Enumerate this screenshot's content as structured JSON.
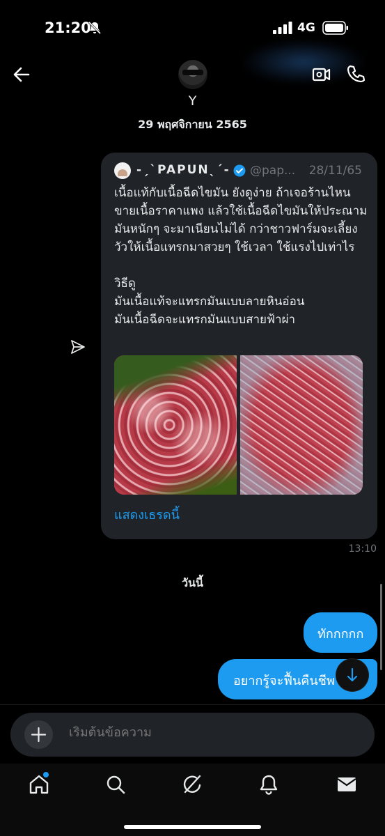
{
  "status_bar": {
    "time": "21:20",
    "network": "4G"
  },
  "header": {
    "contact_name": "Y"
  },
  "conversation": {
    "date_separator": "29 พฤศจิกายน 2565",
    "shared_tweet": {
      "author_name": "-ˏˋPAPUNˎˊ-",
      "handle": "@pap...",
      "date": "28/11/65",
      "text": "เนื้อแท้กับเนื้อฉีดไขมัน ยังดูง่าย ถ้าเจอร้านไหนขายเนื้อราคาแพง แล้วใช้เนื้อฉีดไขมันให้ประณามมันหนักๆ จะมาเนียนไม่ได้  กว่าชาวฟาร์มจะเลี้ยงวัวให้เนื้อแทรกมาสวยๆ ใช้เวลา ใช้แรงไปเท่าไร\n\nวิธีดู\nมันเนื้อแท้จะแทรกมันแบบลายหินอ่อน\nมันเนื้อฉีดจะแทรกมันแบบสายฟ้าผ่า",
      "show_thread_label": "แสดงเธรดนี้"
    },
    "shared_time": "13:10",
    "today_separator": "วันนี้",
    "messages": [
      {
        "text": "ทักกกกก"
      },
      {
        "text": "อยากรู้จะฟื้นคืนชีพ"
      }
    ]
  },
  "composer": {
    "placeholder": "เริ่มต้นข้อความ"
  },
  "colors": {
    "accent": "#1d9bf0",
    "background": "#000000",
    "card": "#202327",
    "muted": "#71767b"
  },
  "icons": [
    "back-arrow-icon",
    "video-call-icon",
    "phone-icon",
    "send-icon",
    "verified-badge-icon",
    "plus-icon",
    "voice-icon",
    "home-icon",
    "search-icon",
    "grok-icon",
    "bell-icon",
    "mail-icon"
  ]
}
